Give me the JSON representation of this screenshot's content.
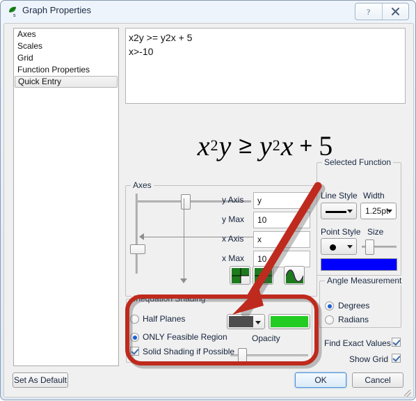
{
  "window": {
    "title": "Graph Properties",
    "app_icon": "leaf-icon",
    "help_button": "?",
    "close_button": "✕"
  },
  "nav": {
    "items": [
      {
        "label": "Axes",
        "selected": false
      },
      {
        "label": "Scales",
        "selected": false
      },
      {
        "label": "Grid",
        "selected": false
      },
      {
        "label": "Function Properties",
        "selected": false
      },
      {
        "label": "Quick Entry",
        "selected": true
      }
    ]
  },
  "quick_entry": {
    "line1": "x2y >= y2x + 5",
    "line2": "x>-10"
  },
  "formula": {
    "lhs_base": "x",
    "lhs_exp": "2",
    "lhs_var": "y",
    "operator": "≥",
    "rhs_base": "y",
    "rhs_exp": "2",
    "rhs_var": "x",
    "plus": "+",
    "constant": "5"
  },
  "axes": {
    "group_title": "Axes",
    "fields": [
      {
        "label": "y Axis",
        "value": "y"
      },
      {
        "label": "y Max",
        "value": "10"
      },
      {
        "label": "x Axis",
        "value": "x"
      },
      {
        "label": "x Max",
        "value": "10"
      }
    ],
    "icon_buttons": [
      {
        "name": "half-grid-icon"
      },
      {
        "name": "full-grid-icon"
      },
      {
        "name": "sine-wave-icon"
      }
    ],
    "grid_color": "#1d7a1d"
  },
  "selected_function": {
    "group_title": "Selected Function",
    "line_style_label": "Line Style",
    "line_style_value": "solid-line-icon",
    "width_label": "Width",
    "width_value": "1.25pt",
    "point_style_label": "Point Style",
    "point_style_value": "filled-dot-icon",
    "size_label": "Size",
    "color": "#0000ff"
  },
  "angle_measurement": {
    "group_title": "Angle Measurement",
    "options": [
      {
        "label": "Degrees",
        "selected": true
      },
      {
        "label": "Radians",
        "selected": false
      }
    ]
  },
  "checkboxes": [
    {
      "label": "Find Exact Values",
      "checked": true
    },
    {
      "label": "Show Grid",
      "checked": true
    }
  ],
  "inequation_shading": {
    "group_title": "Inequation Shading",
    "half_planes_label": "Half Planes",
    "half_planes_selected": false,
    "feasible_label": "ONLY Feasible Region",
    "feasible_selected": true,
    "solid_shading_label": "Solid Shading if Possible",
    "solid_shading_checked": true,
    "shade_color": "#4d4d4d",
    "highlight_color": "#22cc22",
    "opacity_label": "Opacity"
  },
  "buttons": {
    "set_as_default": "Set As Default",
    "ok": "OK",
    "cancel": "Cancel"
  },
  "annotation": {
    "color": "#bf2a1e"
  }
}
